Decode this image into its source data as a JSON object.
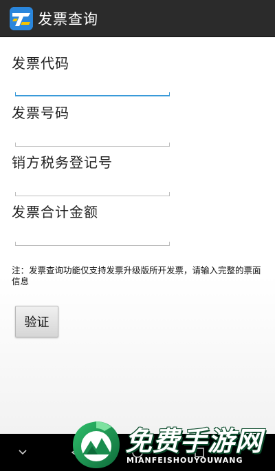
{
  "action_bar": {
    "title": "发票查询",
    "icon": "invoice-app-icon"
  },
  "form": {
    "fields": [
      {
        "label": "发票代码",
        "value": ""
      },
      {
        "label": "发票号码",
        "value": ""
      },
      {
        "label": "销方税务登记号",
        "value": ""
      },
      {
        "label": "发票合计金额",
        "value": ""
      }
    ],
    "note": "注：发票查询功能仅支持发票升级版所开发票，请输入完整的票面信息",
    "verify_label": "验证"
  },
  "nav_bar": {
    "icons": [
      "chevron-down-icon",
      "back-icon",
      "home-icon",
      "recents-icon"
    ]
  },
  "watermark": {
    "title": "免费手游网",
    "subtitle": "MIANFEISHOUYOUWANG"
  },
  "colors": {
    "action_bar": "#2b2b2b",
    "accent_underline": "#3a9ad9",
    "nav_bar": "#000000",
    "watermark_green": "#1a8c4e"
  }
}
